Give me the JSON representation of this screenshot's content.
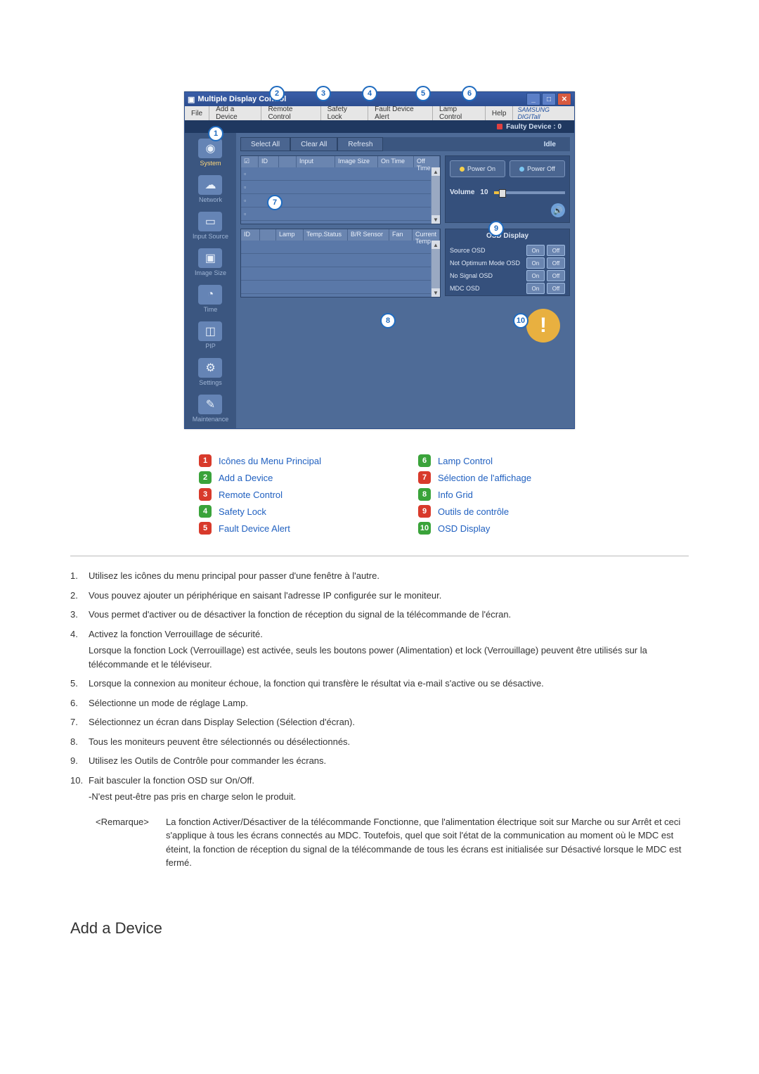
{
  "app": {
    "title": "Multiple Display Control",
    "menubar": [
      "File",
      "Add a Device",
      "Remote Control",
      "Safety Lock",
      "Fault Device Alert",
      "Lamp Control",
      "Help"
    ],
    "brand": "SAMSUNG DIGITall",
    "faulty_label": "Faulty Device : 0",
    "toolbar": {
      "select_all": "Select All",
      "clear_all": "Clear All",
      "refresh": "Refresh",
      "status": "Idle"
    },
    "sidebar": [
      {
        "label": "System",
        "active": true
      },
      {
        "label": "Network"
      },
      {
        "label": "Input Source"
      },
      {
        "label": "Image Size"
      },
      {
        "label": "Time"
      },
      {
        "label": "PIP"
      },
      {
        "label": "Settings"
      },
      {
        "label": "Maintenance"
      }
    ],
    "table1_headers": [
      "☑",
      "ID",
      "",
      "Input",
      "Image Size",
      "On Time",
      "Off Time"
    ],
    "table2_headers": [
      "ID",
      "",
      "Lamp",
      "Temp.Status",
      "B/R Sensor",
      "Fan",
      "Current Temp."
    ],
    "control": {
      "power_on": "Power On",
      "power_off": "Power Off",
      "volume_label": "Volume",
      "volume_value": "10"
    },
    "osd": {
      "title": "OSD Display",
      "rows": [
        "Source OSD",
        "Not Optimum Mode OSD",
        "No Signal OSD",
        "MDC OSD"
      ],
      "on": "On",
      "off": "Off"
    }
  },
  "legend": [
    {
      "num": "1",
      "color": "#d83a2b",
      "label": "Icônes du Menu Principal"
    },
    {
      "num": "2",
      "color": "#3aa33a",
      "label": "Add a Device"
    },
    {
      "num": "3",
      "color": "#d83a2b",
      "label": "Remote Control"
    },
    {
      "num": "4",
      "color": "#3aa33a",
      "label": "Safety Lock"
    },
    {
      "num": "5",
      "color": "#d83a2b",
      "label": "Fault Device Alert"
    },
    {
      "num": "6",
      "color": "#3aa33a",
      "label": "Lamp Control"
    },
    {
      "num": "7",
      "color": "#d83a2b",
      "label": "Sélection de l'affichage"
    },
    {
      "num": "8",
      "color": "#3aa33a",
      "label": "Info Grid"
    },
    {
      "num": "9",
      "color": "#d83a2b",
      "label": "Outils de contrôle"
    },
    {
      "num": "10",
      "color": "#3aa33a",
      "label": "OSD Display"
    }
  ],
  "numbered": [
    "Utilisez les icônes du menu principal pour passer d'une fenêtre à l'autre.",
    "Vous pouvez ajouter un périphérique en saisant l'adresse IP configurée sur le moniteur.",
    "Vous permet d'activer ou de désactiver la fonction de réception du signal de la télécommande de l'écran.",
    "Activez la fonction Verrouillage de sécurité.\nLorsque la fonction Lock (Verrouillage) est activée, seuls les boutons power (Alimentation) et lock (Verrouillage) peuvent être utilisés sur la télécommande et le téléviseur.",
    "Lorsque la connexion au moniteur échoue, la fonction qui transfère le résultat via e-mail s'active ou se désactive.",
    "Sélectionne un mode de réglage Lamp.",
    "Sélectionnez un écran dans Display Selection (Sélection d'écran).",
    "Tous les moniteurs peuvent être sélectionnés ou désélectionnés.",
    "Utilisez les Outils de Contrôle pour commander les écrans.",
    "Fait basculer la fonction OSD sur On/Off.\n-N'est peut-être pas pris en charge selon le produit."
  ],
  "remark": {
    "label": "<Remarque>",
    "text": "La fonction Activer/Désactiver de la télécommande Fonctionne, que l'alimentation électrique soit sur Marche ou sur Arrêt et ceci s'applique à tous les écrans connectés au MDC. Toutefois, quel que soit l'état de la communication au moment où le MDC est éteint, la fonction de réception du signal de la télécommande de tous les écrans est initialisée sur Désactivé lorsque le MDC est fermé."
  },
  "section_heading": "Add a Device"
}
